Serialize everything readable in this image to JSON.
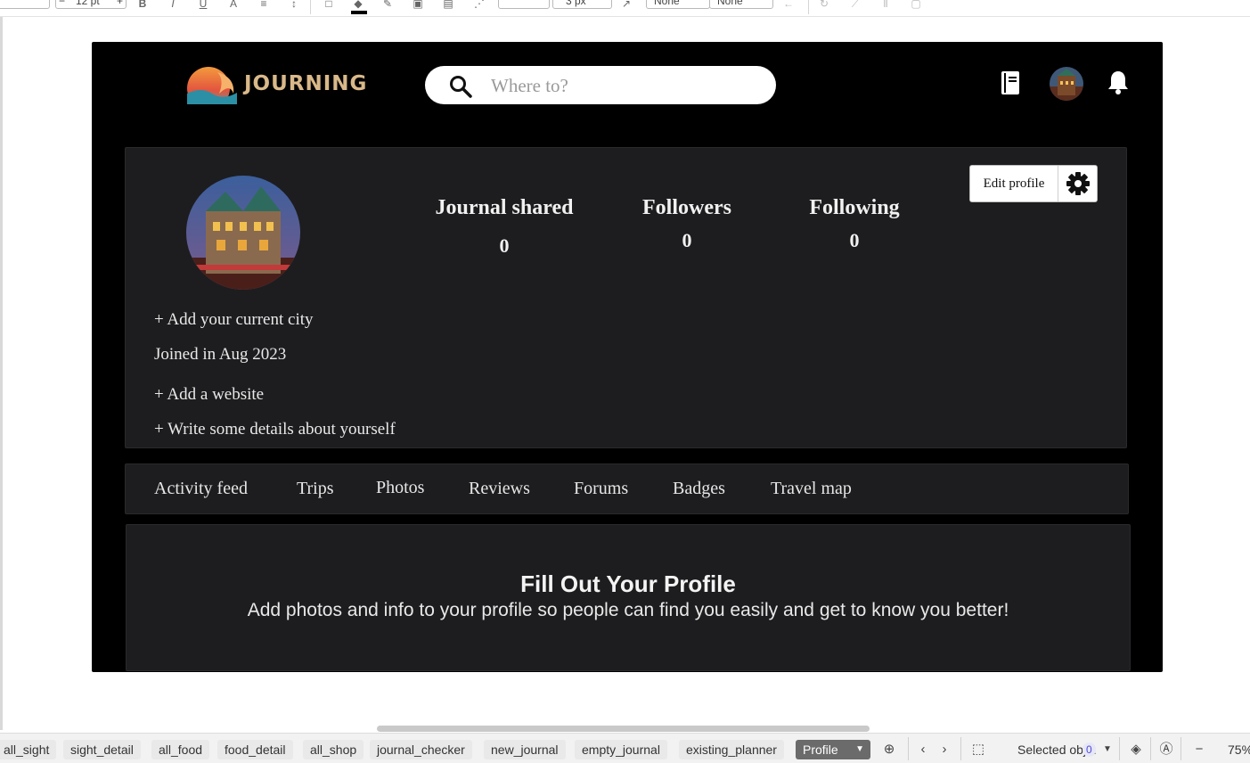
{
  "toolbar": {
    "font_size": "12 pt",
    "line_width": "3 px",
    "arrow_start": "None",
    "arrow_end": "None"
  },
  "app": {
    "logo_text": "JOURNING",
    "search": {
      "placeholder": "Where to?"
    },
    "profile": {
      "links": {
        "add_city": "+ Add your current city",
        "joined": "Joined in Aug 2023",
        "add_website": "+ Add a website",
        "write_details": "+ Write some details about yourself"
      },
      "stats": [
        {
          "label": "Journal shared",
          "value": "0"
        },
        {
          "label": "Followers",
          "value": "0"
        },
        {
          "label": "Following",
          "value": "0"
        }
      ],
      "edit_label": "Edit profile"
    },
    "tabs": [
      "Activity feed",
      "Trips",
      "Photos",
      "Reviews",
      "Forums",
      "Badges",
      "Travel map"
    ],
    "empty_state": {
      "title": "Fill Out Your Profile",
      "description": "Add photos and info to your profile so people can find you easily and get to know you better!"
    }
  },
  "sheets": {
    "tabs": [
      "all_sight",
      "sight_detail",
      "all_food",
      "food_detail",
      "all_shop",
      "journal_checker",
      "new_journal",
      "empty_journal",
      "existing_planner"
    ],
    "active": "Profile"
  },
  "status": {
    "selected_label": "Selected obj...",
    "selected_count": "0",
    "zoom": "75%"
  },
  "colors": {
    "app_background": "#000000",
    "card_background": "#1d1d1f",
    "logo_gold": "#d9b889",
    "active_sheet": "#6b6b6b"
  }
}
